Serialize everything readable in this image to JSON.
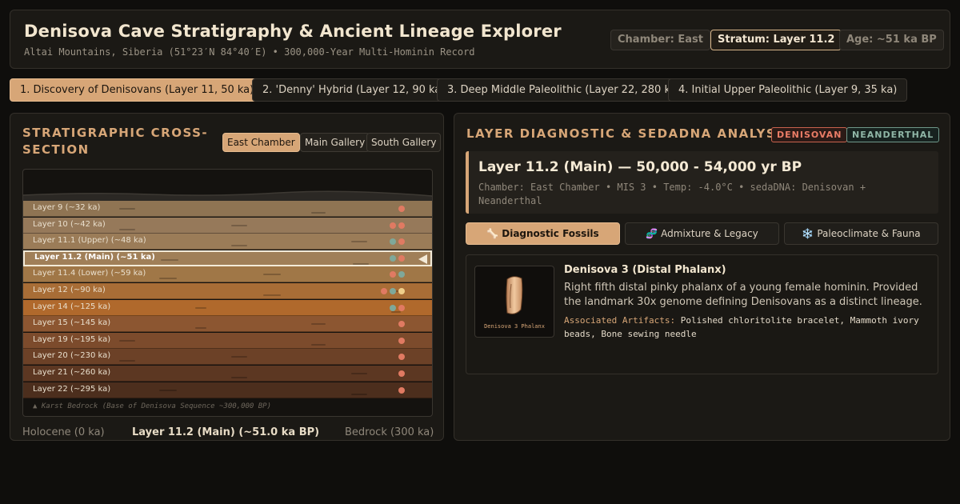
{
  "header": {
    "title": "Denisova Cave Stratigraphy & Ancient Lineage Explorer",
    "subtitle": "Altai Mountains, Siberia (51°23′N 84°40′E) • 300,000-Year Multi-Hominin Record",
    "pills": [
      "Chamber: East",
      "Stratum: Layer 11.2",
      "Age: ~51 ka BP"
    ]
  },
  "scenarios": [
    "1. Discovery of Denisovans (Layer 11, 50 ka)",
    "2. 'Denny' Hybrid (Layer 12, 90 ka)",
    "3. Deep Middle Paleolithic (Layer 22, 280 ka)",
    "4. Initial Upper Paleolithic (Layer 9, 35 ka)"
  ],
  "left": {
    "title_line1": "STRATIGRAPHIC CROSS-",
    "title_line2": "SECTION",
    "chambers": [
      "East Chamber",
      "Main Gallery",
      "South Gallery"
    ],
    "layers": [
      {
        "name": "Layer 9 (~32 ka)",
        "color": "#8f7453",
        "dots": [
          "d"
        ]
      },
      {
        "name": "Layer 10 (~42 ka)",
        "color": "#96795a",
        "dots": [
          "d",
          "d"
        ]
      },
      {
        "name": "Layer 11.1 (Upper) (~48 ka)",
        "color": "#9b7c58",
        "dots": [
          "n",
          "d"
        ]
      },
      {
        "name": "Layer 11.2 (Main) (~51 ka)",
        "color": "#a07f58",
        "dots": [
          "n",
          "d"
        ]
      },
      {
        "name": "Layer 11.4 (Lower) (~59 ka)",
        "color": "#a07747",
        "dots": [
          "d",
          "n"
        ]
      },
      {
        "name": "Layer 12 (~90 ka)",
        "color": "#a86d36",
        "dots": [
          "d",
          "n",
          "m"
        ]
      },
      {
        "name": "Layer 14 (~125 ka)",
        "color": "#b0692c",
        "dots": [
          "n",
          "d"
        ]
      },
      {
        "name": "Layer 15 (~145 ka)",
        "color": "#8c5631",
        "dots": [
          "d"
        ]
      },
      {
        "name": "Layer 19 (~195 ka)",
        "color": "#7c4b2c",
        "dots": [
          "d"
        ]
      },
      {
        "name": "Layer 20 (~230 ka)",
        "color": "#6c4127",
        "dots": [
          "d"
        ]
      },
      {
        "name": "Layer 21 (~260 ka)",
        "color": "#5c3722",
        "dots": [
          "d"
        ]
      },
      {
        "name": "Layer 22 (~295 ka)",
        "color": "#4c2e1d",
        "dots": [
          "d"
        ]
      }
    ],
    "selected_index": 3,
    "bedrock": "▲ Karst Bedrock (Base of Denisova Sequence ~300,000 BP)",
    "scale_left": "Holocene (0 ka)",
    "scale_center": "Layer 11.2 (Main) (~51.0 ka BP)",
    "scale_right": "Bedrock (300 ka)"
  },
  "right": {
    "title": "LAYER DIAGNOSTIC & SEDADNA ANALYSIS",
    "badges": [
      "DENISOVAN",
      "NEANDERTHAL"
    ],
    "layer_heading": "Layer 11.2 (Main) — 50,000 - 54,000 yr BP",
    "layer_meta": "Chamber: East Chamber • MIS 3 • Temp: -4.0°C • sedaDNA: Denisovan + Neanderthal",
    "tabs": [
      {
        "icon": "🦴",
        "label": "Diagnostic Fossils"
      },
      {
        "icon": "🧬",
        "label": "Admixture & Legacy"
      },
      {
        "icon": "❄️",
        "label": "Paleoclimate & Fauna"
      }
    ],
    "fossil": {
      "thumb_caption": "Denisova 3 Phalanx",
      "name": "Denisova 3 (Distal Phalanx)",
      "desc": "Right fifth distal pinky phalanx of a young female hominin. Provided the landmark 30x genome defining Denisovans as a distinct lineage.",
      "artifacts_label": "Associated Artifacts:",
      "artifacts": "Polished chloritolite bracelet, Mammoth ivory beads, Bone sewing needle"
    }
  }
}
